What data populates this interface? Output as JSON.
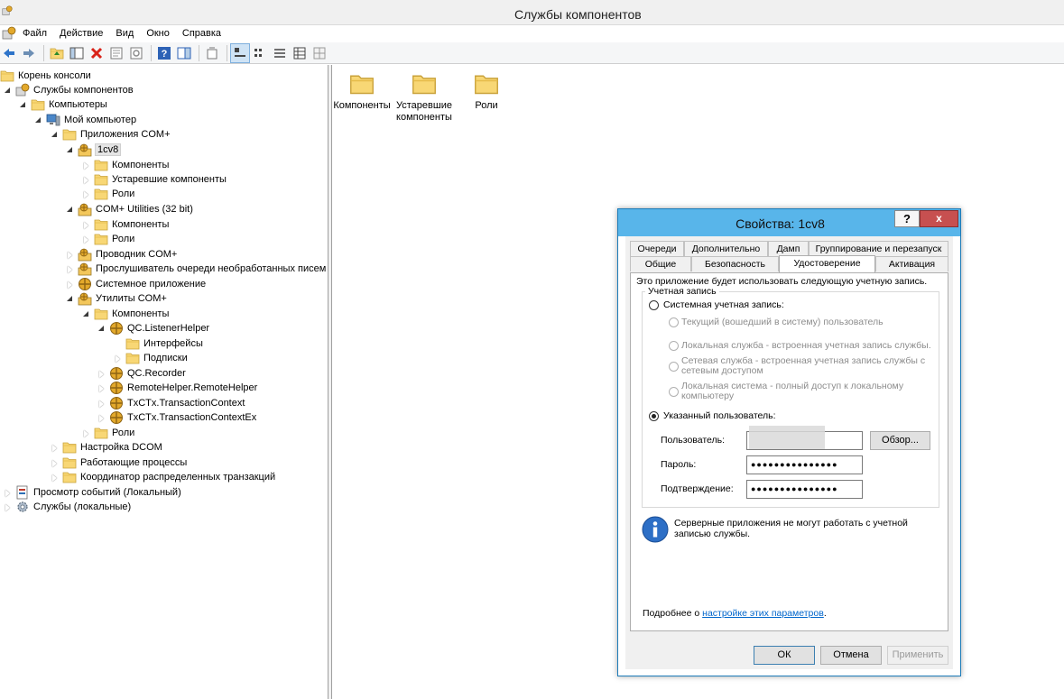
{
  "window": {
    "title": "Службы компонентов"
  },
  "menu": {
    "items": [
      "Файл",
      "Действие",
      "Вид",
      "Окно",
      "Справка"
    ]
  },
  "tree": {
    "nodes": [
      {
        "label": "Корень консоли",
        "icon": "folder-icon"
      },
      {
        "label": "Службы компонентов",
        "icon": "component-services-icon"
      },
      {
        "label": "Компьютеры",
        "icon": "folder-icon"
      },
      {
        "label": "Мой компьютер",
        "icon": "computer-icon"
      },
      {
        "label": "Приложения COM+",
        "icon": "folder-icon"
      },
      {
        "label": "1cv8",
        "icon": "com-application-icon"
      },
      {
        "label": "Компоненты",
        "icon": "folder-icon"
      },
      {
        "label": "Устаревшие компоненты",
        "icon": "folder-icon"
      },
      {
        "label": "Роли",
        "icon": "folder-icon"
      },
      {
        "label": "COM+ Utilities (32 bit)",
        "icon": "com-application-icon"
      },
      {
        "label": "Компоненты",
        "icon": "folder-icon"
      },
      {
        "label": "Роли",
        "icon": "folder-icon"
      },
      {
        "label": "Проводник COM+",
        "icon": "com-application-icon"
      },
      {
        "label": "Прослушиватель очереди необработанных писем",
        "icon": "com-application-icon"
      },
      {
        "label": "Системное приложение",
        "icon": "system-application-icon"
      },
      {
        "label": "Утилиты COM+",
        "icon": "com-application-icon"
      },
      {
        "label": "Компоненты",
        "icon": "folder-icon"
      },
      {
        "label": "QC.ListenerHelper",
        "icon": "component-icon"
      },
      {
        "label": "Интерфейсы",
        "icon": "folder-icon"
      },
      {
        "label": "Подписки",
        "icon": "folder-icon"
      },
      {
        "label": "QC.Recorder",
        "icon": "component-icon"
      },
      {
        "label": "RemoteHelper.RemoteHelper",
        "icon": "component-icon"
      },
      {
        "label": "TxCTx.TransactionContext",
        "icon": "component-icon"
      },
      {
        "label": "TxCTx.TransactionContextEx",
        "icon": "component-icon"
      },
      {
        "label": "Роли",
        "icon": "folder-icon"
      },
      {
        "label": "Настройка DCOM",
        "icon": "folder-icon"
      },
      {
        "label": "Работающие процессы",
        "icon": "folder-icon"
      },
      {
        "label": "Координатор распределенных транзакций",
        "icon": "folder-icon"
      },
      {
        "label": "Просмотр событий (Локальный)",
        "icon": "event-viewer-icon"
      },
      {
        "label": "Службы (локальные)",
        "icon": "services-icon"
      }
    ]
  },
  "content": {
    "items": [
      {
        "label": "Компоненты"
      },
      {
        "label": "Устаревшие компоненты"
      },
      {
        "label": "Роли"
      }
    ]
  },
  "dialog": {
    "title": "Свойства: 1cv8",
    "help": "?",
    "close": "x",
    "tabs_row1": [
      "Очереди",
      "Дополнительно",
      "Дамп",
      "Группирование и перезапуск"
    ],
    "tabs_row2": [
      "Общие",
      "Безопасность",
      "Удостоверение",
      "Активация"
    ],
    "active_tab": "Удостоверение",
    "intro": "Это приложение будет использовать следующую учетную запись.",
    "group_label": "Учетная запись",
    "system_account": "Системная учетная запись:",
    "opt_interactive": "Текущий (вошедший в систему) пользователь",
    "opt_local_service": "Локальная служба - встроенная учетная запись службы.",
    "opt_network_service_1": "Сетевая служба - встроенная учетная запись службы с",
    "opt_network_service_2": "сетевым доступом",
    "opt_local_system_1": "Локальная система - полный доступ к локальному",
    "opt_local_system_2": "компьютеру",
    "specified_user": "Указанный пользователь:",
    "user_label": "Пользователь:",
    "user_value": "",
    "browse": "Обзор...",
    "password_label": "Пароль:",
    "password_value": "●●●●●●●●●●●●●●●",
    "confirm_label": "Подтверждение:",
    "confirm_value": "●●●●●●●●●●●●●●●",
    "info_1": "Серверные приложения не могут работать с учетной",
    "info_2": "записью службы.",
    "more_prefix": "Подробнее о ",
    "more_link": "настройке этих параметров",
    "more_suffix": ".",
    "ok": "ОК",
    "cancel": "Отмена",
    "apply": "Применить"
  },
  "colors": {
    "dialog_title_bg": "#58b5ea",
    "close_button": "#c75050",
    "link": "#0066cc",
    "folder": "#f7d36c"
  }
}
